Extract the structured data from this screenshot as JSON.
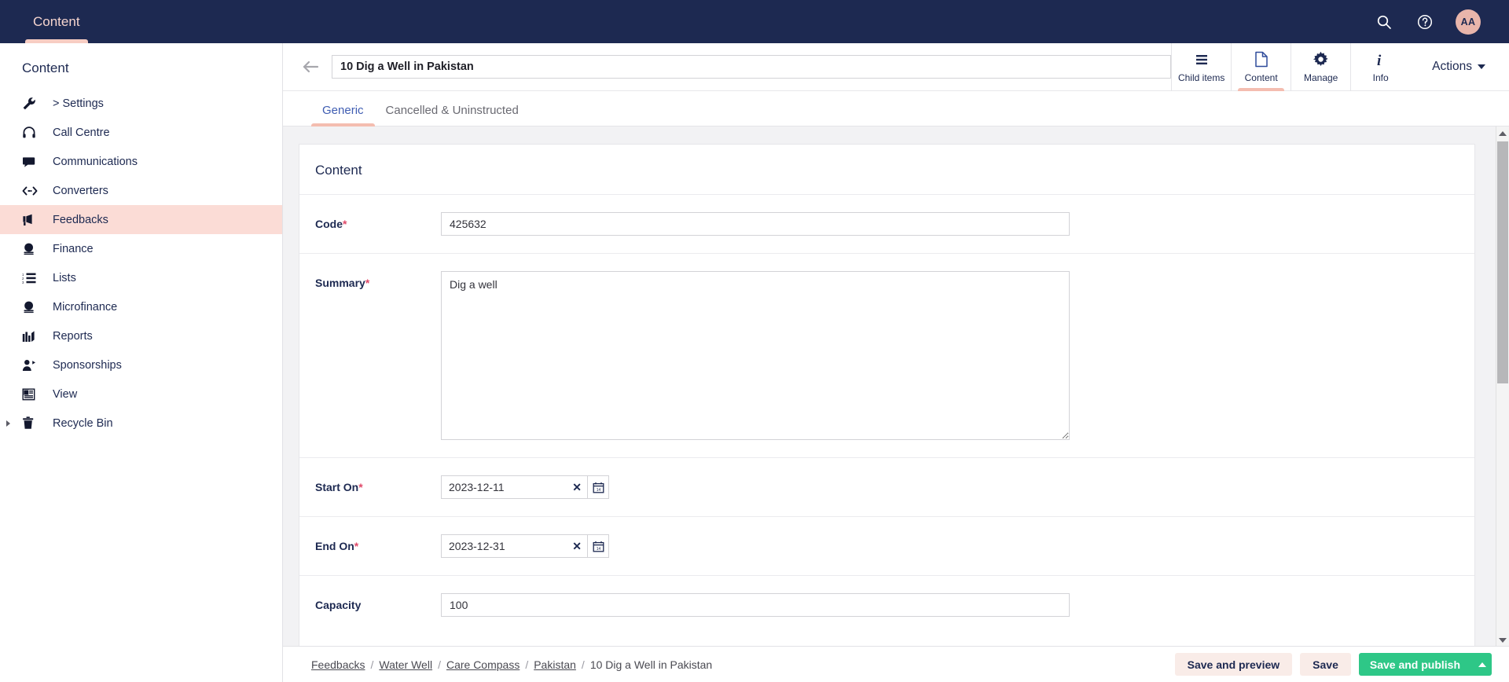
{
  "navbar": {
    "tab_label": "Content",
    "search_icon": "search-icon",
    "help_icon": "help-circle-icon",
    "avatar_initials": "AA",
    "background": "#1d2951",
    "accent": "#f7cdc3"
  },
  "sidebar": {
    "title": "Content",
    "active_item": "Feedbacks",
    "items": [
      {
        "label": "> Settings",
        "icon": "wrench-icon",
        "expandable": false
      },
      {
        "label": "Call Centre",
        "icon": "headset-icon",
        "expandable": false
      },
      {
        "label": "Communications",
        "icon": "speech-bubble-icon",
        "expandable": false
      },
      {
        "label": "Converters",
        "icon": "code-arrows-icon",
        "expandable": false
      },
      {
        "label": "Feedbacks",
        "icon": "megaphone-icon",
        "expandable": false
      },
      {
        "label": "Finance",
        "icon": "coin-stack-icon",
        "expandable": false
      },
      {
        "label": "Lists",
        "icon": "numbered-list-icon",
        "expandable": false
      },
      {
        "label": "Microfinance",
        "icon": "coin-stack-icon",
        "expandable": false
      },
      {
        "label": "Reports",
        "icon": "bar-chart-icon",
        "expandable": false
      },
      {
        "label": "Sponsorships",
        "icon": "person-plus-icon",
        "expandable": false
      },
      {
        "label": "View",
        "icon": "article-icon",
        "expandable": false
      },
      {
        "label": "Recycle Bin",
        "icon": "trash-icon",
        "expandable": true
      }
    ]
  },
  "page_head": {
    "back_icon": "arrow-left-icon",
    "title_value": "10 Dig a Well in Pakistan",
    "tools": [
      {
        "label": "Child items",
        "icon": "hamburger-icon",
        "active": false
      },
      {
        "label": "Content",
        "icon": "document-icon",
        "active": true
      },
      {
        "label": "Manage",
        "icon": "gear-icon",
        "active": false
      },
      {
        "label": "Info",
        "icon": "info-italic-icon",
        "active": false
      }
    ],
    "actions_label": "Actions"
  },
  "tabs": [
    {
      "label": "Generic",
      "active": true
    },
    {
      "label": "Cancelled & Uninstructed",
      "active": false
    }
  ],
  "form": {
    "card_title": "Content",
    "fields": [
      {
        "label": "Code",
        "required": true,
        "type": "text",
        "value": "425632"
      },
      {
        "label": "Summary",
        "required": true,
        "type": "textarea",
        "value": "Dig a well"
      },
      {
        "label": "Start On",
        "required": true,
        "type": "date",
        "value": "2023-12-11",
        "clear_icon": "close-x-icon",
        "calendar_icon": "calendar-icon"
      },
      {
        "label": "End On",
        "required": true,
        "type": "date",
        "value": "2023-12-31",
        "clear_icon": "close-x-icon",
        "calendar_icon": "calendar-icon"
      },
      {
        "label": "Capacity",
        "required": false,
        "type": "text",
        "value": "100"
      }
    ]
  },
  "footer": {
    "breadcrumb": [
      {
        "label": "Feedbacks",
        "link": true
      },
      {
        "label": "Water Well",
        "link": true
      },
      {
        "label": "Care Compass",
        "link": true
      },
      {
        "label": "Pakistan",
        "link": true
      },
      {
        "label": "10 Dig a Well in Pakistan",
        "link": false
      }
    ],
    "separator": "/",
    "save_preview_label": "Save and preview",
    "save_label": "Save",
    "save_publish_label": "Save and publish",
    "publish_caret_icon": "caret-up-icon",
    "publish_color": "#2ec787"
  }
}
